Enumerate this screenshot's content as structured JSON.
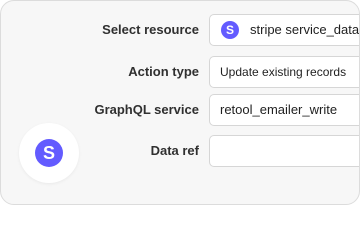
{
  "form": {
    "select_resource": {
      "label": "Select resource",
      "value": "stripe service_data_",
      "icon": "stripe-icon",
      "icon_glyph": "S"
    },
    "action_type": {
      "label": "Action type",
      "value": "Update existing records"
    },
    "graphql_service": {
      "label": "GraphQL service",
      "value": "retool_emailer_write"
    },
    "data_ref": {
      "label": "Data ref",
      "value": ""
    }
  },
  "logo": {
    "icon": "stripe-logo-icon",
    "glyph": "S",
    "color": "#635bff"
  }
}
